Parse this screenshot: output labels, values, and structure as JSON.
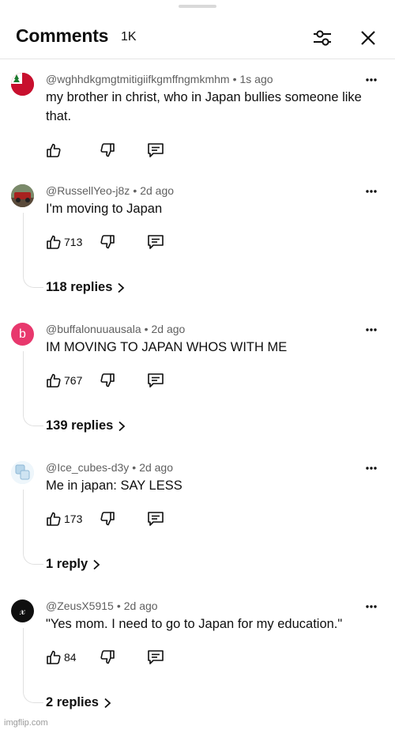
{
  "header": {
    "title": "Comments",
    "count": "1K"
  },
  "icons": {
    "filter": "sliders-icon",
    "close": "close-icon",
    "like": "thumbs-up-icon",
    "dislike": "thumbs-down-icon",
    "reply": "reply-comment-icon",
    "more": "more-dots-icon",
    "chevron": "chevron-right-icon"
  },
  "comments": [
    {
      "author": "@wghhdkgmgtmitigiifkgmffngmkmhm",
      "time": "1s ago",
      "text": "my brother in christ, who in Japan bullies someone like that.",
      "likes": "",
      "replies": "",
      "avatar_color": "#c8102e"
    },
    {
      "author": "@RussellYeo-j8z",
      "time": "2d ago",
      "text": "I'm moving to Japan",
      "likes": "713",
      "replies": "118 replies",
      "avatar_color": "#6b5a4e"
    },
    {
      "author": "@buffalonuuausala",
      "time": "2d ago",
      "text": "IM MOVING TO JAPAN WHOS WITH ME",
      "likes": "767",
      "replies": "139 replies",
      "avatar_color": "#e8386d",
      "avatar_letter": "b"
    },
    {
      "author": "@Ice_cubes-d3y",
      "time": "2d ago",
      "text": "Me in japan: SAY LESS",
      "likes": "173",
      "replies": "1 reply",
      "avatar_color": "#b8d6ea"
    },
    {
      "author": "@ZeusX5915",
      "time": "2d ago",
      "text": "\"Yes mom. I need to go to Japan for my education.\"",
      "likes": "84",
      "replies": "2 replies",
      "avatar_color": "#0f0f0f",
      "avatar_letter": "𝓍"
    }
  ],
  "watermark": "imgflip.com"
}
